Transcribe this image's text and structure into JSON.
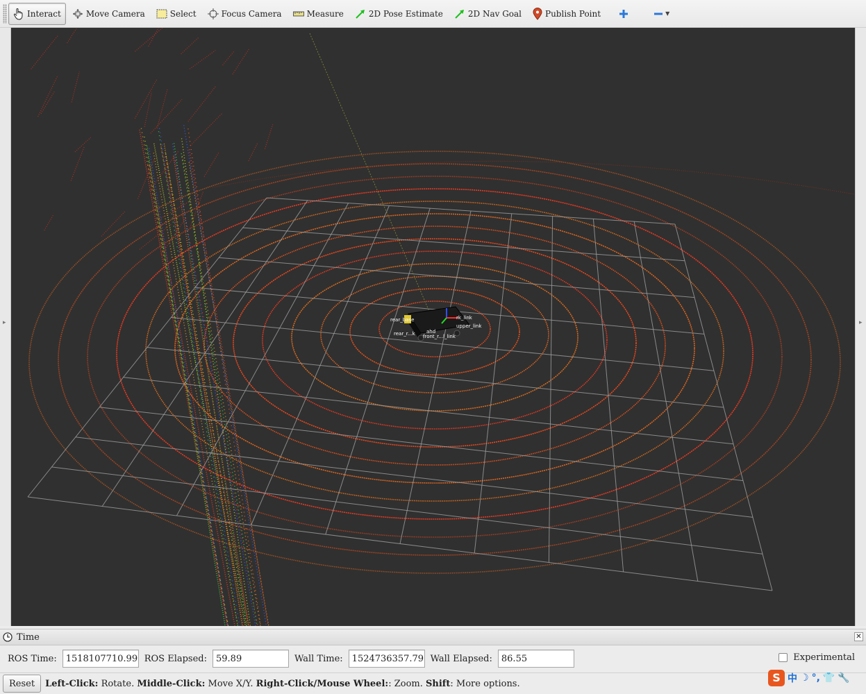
{
  "toolbar": {
    "tools": [
      {
        "label": "Interact",
        "icon": "hand-pointer-icon",
        "active": true
      },
      {
        "label": "Move Camera",
        "icon": "move-camera-icon"
      },
      {
        "label": "Select",
        "icon": "select-rectangle-icon"
      },
      {
        "label": "Focus Camera",
        "icon": "focus-crosshair-icon"
      },
      {
        "label": "Measure",
        "icon": "ruler-icon"
      },
      {
        "label": "2D Pose Estimate",
        "icon": "green-arrow-icon"
      },
      {
        "label": "2D Nav Goal",
        "icon": "green-arrow-icon"
      },
      {
        "label": "Publish Point",
        "icon": "map-pin-icon"
      }
    ],
    "add_tool_icon": "plus-icon",
    "remove_tool_icon": "minus-icon"
  },
  "viewport": {
    "background": "#303030",
    "grid_color": "#a0a0a0",
    "robot_frame_labels": [
      "rear_base",
      "rk_link",
      "upper_link",
      "rear_r...k",
      "front_r...l_link",
      "ahd"
    ]
  },
  "time_panel": {
    "title": "Time",
    "ros_time_label": "ROS Time:",
    "ros_time_value": "1518107710.99",
    "ros_elapsed_label": "ROS Elapsed:",
    "ros_elapsed_value": "59.89",
    "wall_time_label": "Wall Time:",
    "wall_time_value": "1524736357.79",
    "wall_elapsed_label": "Wall Elapsed:",
    "wall_elapsed_value": "86.55",
    "experimental_label": "Experimental",
    "experimental_checked": false
  },
  "statusbar": {
    "reset_label": "Reset",
    "hint_left_click": "Left-Click:",
    "hint_rotate": " Rotate. ",
    "hint_middle_click": "Middle-Click:",
    "hint_move": " Move X/Y. ",
    "hint_right_click": "Right-Click/Mouse Wheel:",
    "hint_zoom": ": Zoom. ",
    "hint_shift": "Shift",
    "hint_more": ": More options."
  },
  "ime": {
    "logo": "S",
    "items": [
      "中",
      "☽",
      "°,",
      "👕",
      "🔧"
    ]
  }
}
